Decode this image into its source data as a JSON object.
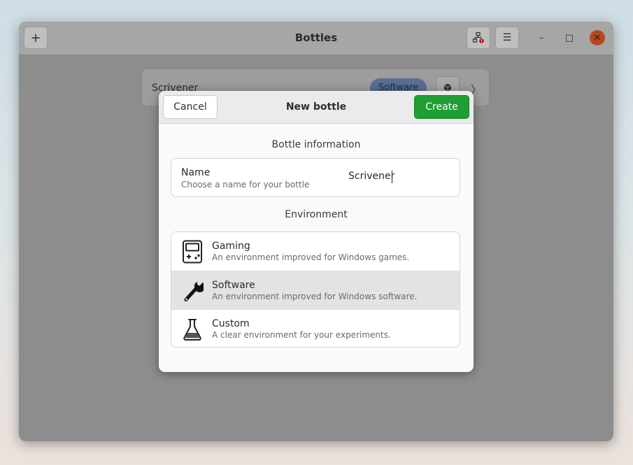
{
  "window": {
    "title": "Bottles",
    "add_icon": "plus-icon",
    "glyph_plus": "+",
    "glyph_menu": "☰",
    "glyph_minimize": "–",
    "glyph_maximize": "□",
    "glyph_close": "✕"
  },
  "bottle_list": {
    "items": [
      {
        "name": "Scrivener",
        "badge": "Software",
        "glyph_chevron": "〉"
      }
    ]
  },
  "dialog": {
    "title": "New bottle",
    "cancel_label": "Cancel",
    "create_label": "Create",
    "info_section_title": "Bottle information",
    "name_row": {
      "title": "Name",
      "subtitle": "Choose a name for your bottle",
      "value": "Scrivener"
    },
    "env_section_title": "Environment",
    "environments": [
      {
        "title": "Gaming",
        "subtitle": "An environment improved for Windows games.",
        "icon": "gamepad-icon",
        "selected": false
      },
      {
        "title": "Software",
        "subtitle": "An environment improved for Windows software.",
        "icon": "wrench-icon",
        "selected": true
      },
      {
        "title": "Custom",
        "subtitle": "A clear environment for your experiments.",
        "icon": "flask-icon",
        "selected": false
      }
    ]
  },
  "colors": {
    "accent_create": "#1e9e33",
    "close_button": "#b5481f",
    "badge": "#5a6e92",
    "selected_row": "#e3e3e3"
  }
}
